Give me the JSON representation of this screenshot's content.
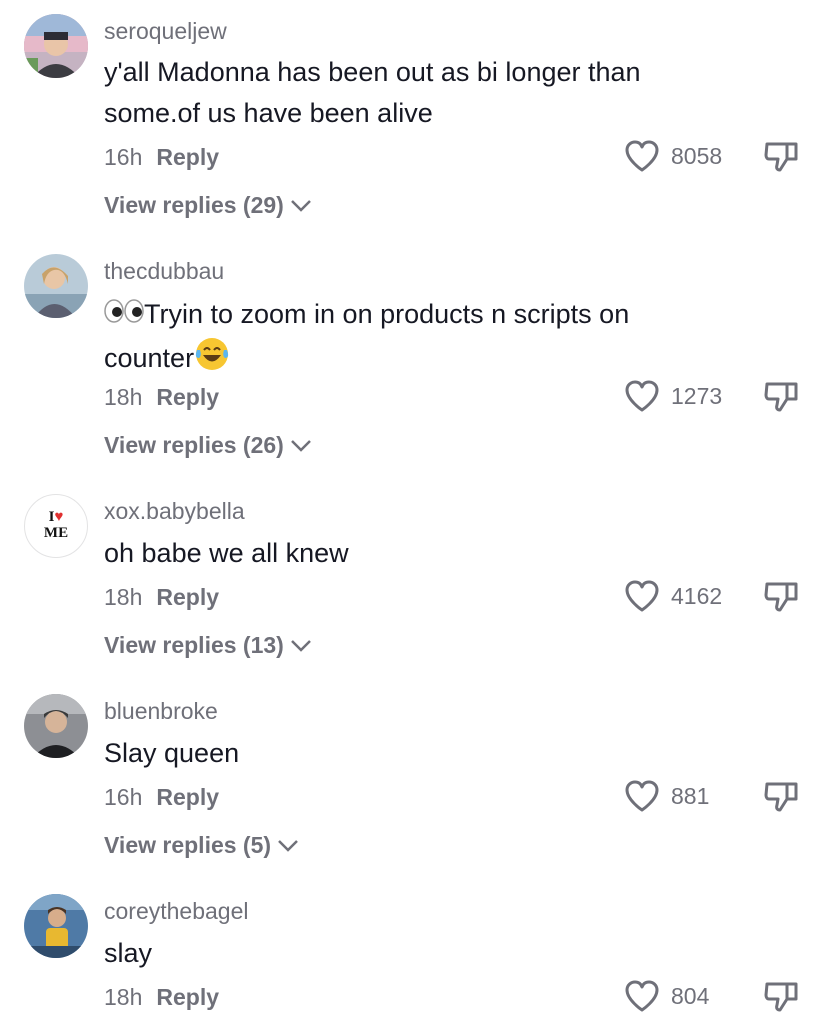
{
  "comments": [
    {
      "username": "seroqueljew",
      "text_lines": [
        "y'all Madonna has been out as bi longer than",
        "some.of us have been alive"
      ],
      "time": "16h",
      "reply_label": "Reply",
      "likes": "8058",
      "view_replies": "View replies (29)"
    },
    {
      "username": "thecdubbau",
      "text_lines": [
        "Tryin to zoom in on products n scripts on",
        "counter"
      ],
      "time": "18h",
      "reply_label": "Reply",
      "likes": "1273",
      "view_replies": "View replies (26)"
    },
    {
      "username": "xox.babybella",
      "avatar_text": [
        "I",
        "ME"
      ],
      "text_lines": [
        "oh babe we all knew"
      ],
      "time": "18h",
      "reply_label": "Reply",
      "likes": "4162",
      "view_replies": "View replies (13)"
    },
    {
      "username": "bluenbroke",
      "text_lines": [
        "Slay queen"
      ],
      "time": "16h",
      "reply_label": "Reply",
      "likes": "881",
      "view_replies": "View replies (5)"
    },
    {
      "username": "coreythebagel",
      "text_lines": [
        "slay"
      ],
      "time": "18h",
      "reply_label": "Reply",
      "likes": "804"
    }
  ],
  "colors": {
    "text": "#161823",
    "secondary": "#6f7079",
    "heart_red": "#e03030"
  },
  "icons": [
    "heart-outline-icon",
    "thumbs-down-icon",
    "chevron-down-icon",
    "eyes-emoji",
    "laughing-tears-emoji"
  ]
}
